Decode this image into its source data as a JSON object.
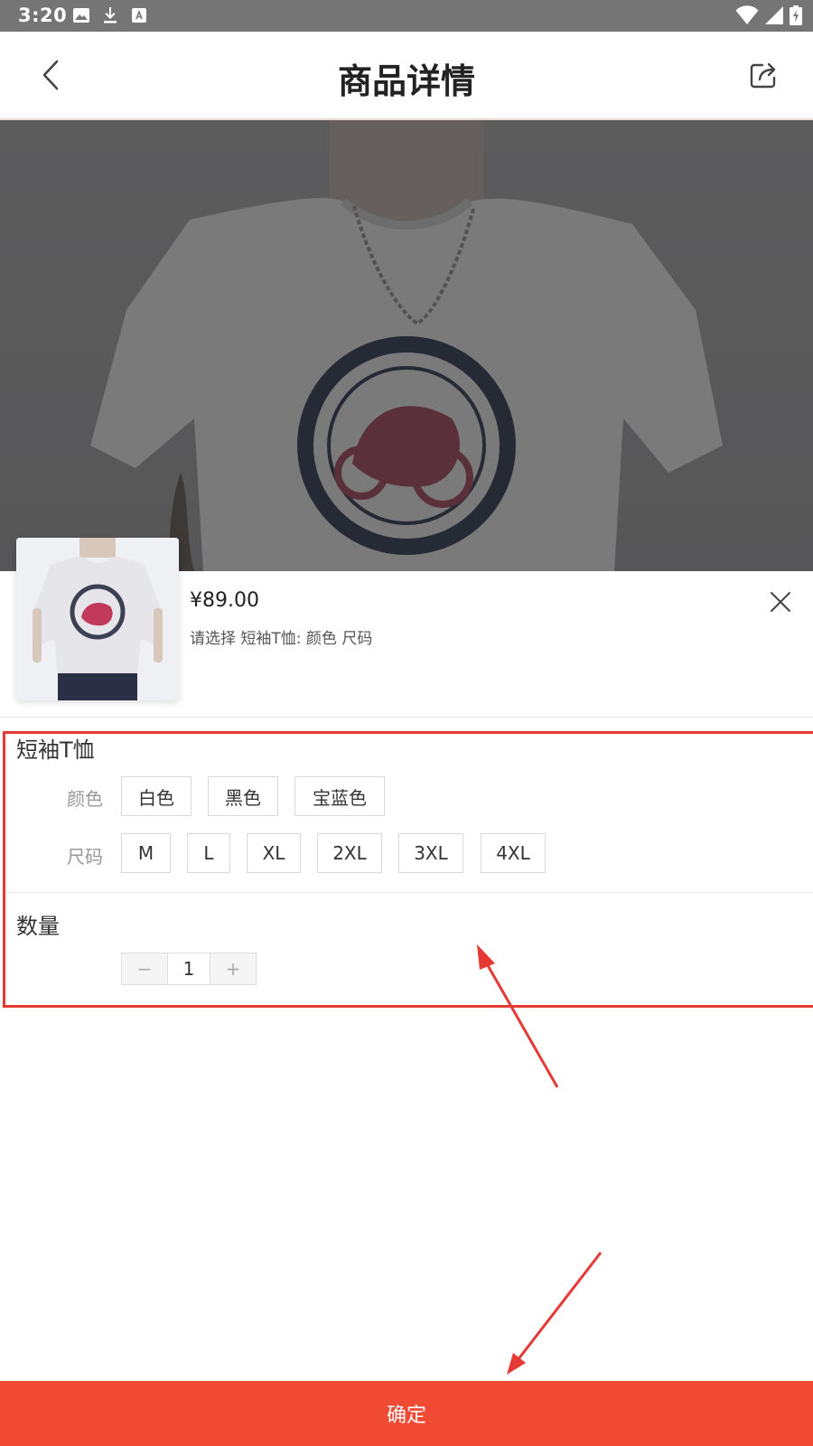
{
  "status_bar": {
    "time": "3:20",
    "left_icons": [
      "image-icon",
      "download-icon",
      "text-a-icon"
    ],
    "right_icons": [
      "wifi-icon",
      "signal-icon",
      "battery-charging-icon"
    ]
  },
  "header": {
    "title": "商品详情",
    "back_icon": "chevron-left-icon",
    "share_icon": "share-icon"
  },
  "sheet": {
    "price": "¥89.00",
    "select_hint": "请选择 短袖T恤: 颜色 尺码",
    "close_icon": "close-icon",
    "spec_title": "短袖T恤",
    "color_label": "颜色",
    "colors": [
      "白色",
      "黑色",
      "宝蓝色"
    ],
    "size_label": "尺码",
    "sizes": [
      "M",
      "L",
      "XL",
      "2XL",
      "3XL",
      "4XL"
    ],
    "quantity_title": "数量",
    "quantity": {
      "minus": "−",
      "value": "1",
      "plus": "+"
    }
  },
  "confirm_label": "确定",
  "colors": {
    "accent": "#f04a34",
    "annotation": "#e53935",
    "status_bar": "#757575"
  }
}
